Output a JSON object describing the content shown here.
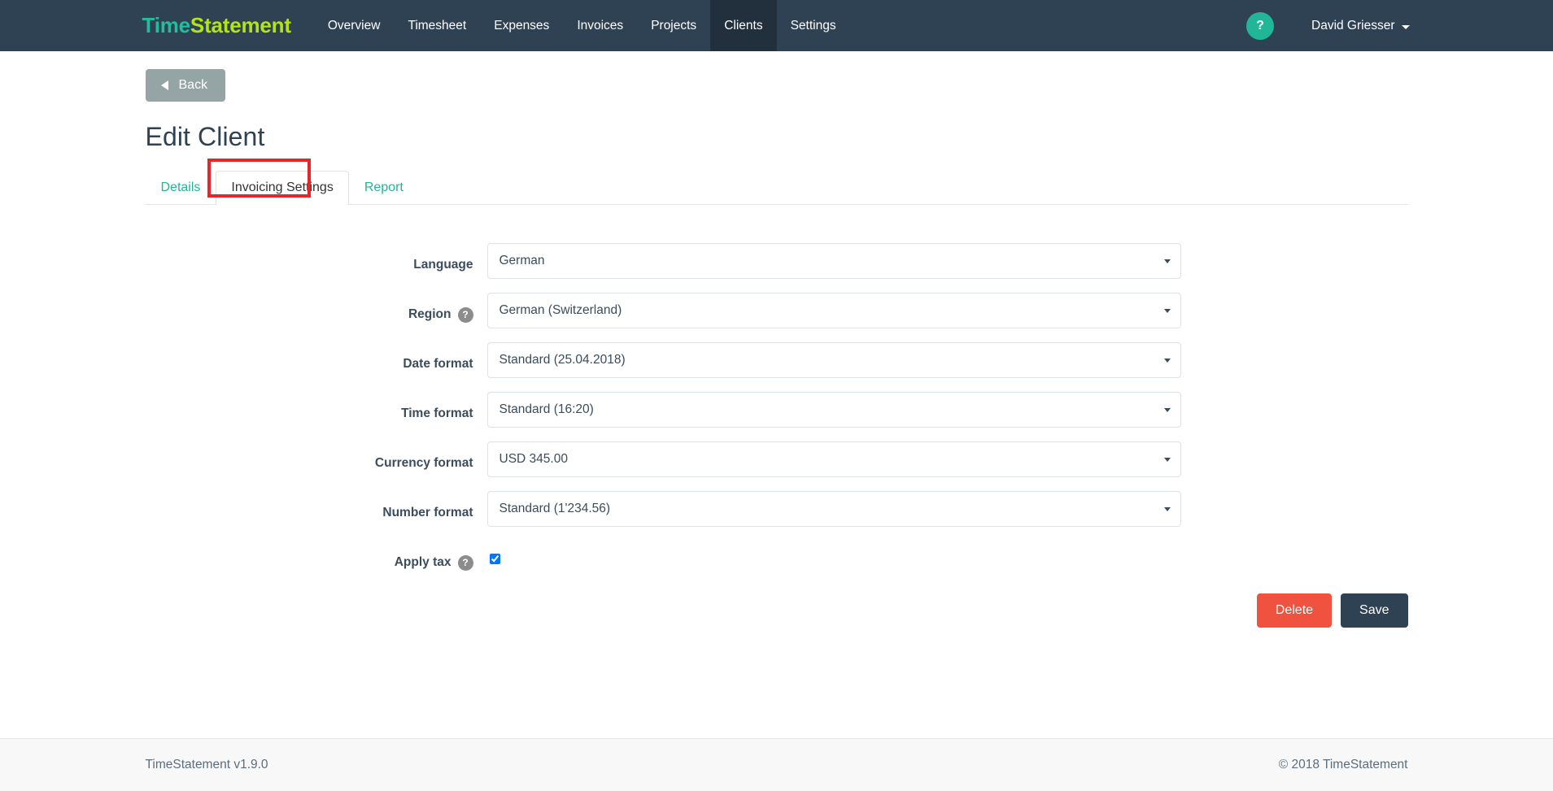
{
  "navbar": {
    "brand_part1": "Time",
    "brand_part2": "Statement",
    "links": [
      {
        "label": "Overview",
        "active": false
      },
      {
        "label": "Timesheet",
        "active": false
      },
      {
        "label": "Expenses",
        "active": false
      },
      {
        "label": "Invoices",
        "active": false
      },
      {
        "label": "Projects",
        "active": false
      },
      {
        "label": "Clients",
        "active": true
      },
      {
        "label": "Settings",
        "active": false
      }
    ],
    "help_badge": "?",
    "user_name": "David Griesser",
    "colors": {
      "background": "#2f4254",
      "active_background": "#22303d",
      "brand_teal": "#1fbf9c",
      "brand_lime": "#b4e316",
      "help_badge": "#21b698"
    }
  },
  "toolbar": {
    "back_label": "Back"
  },
  "page": {
    "title": "Edit Client"
  },
  "tabs": {
    "items": [
      {
        "label": "Details",
        "active": false
      },
      {
        "label": "Invoicing Settings",
        "active": true
      },
      {
        "label": "Report",
        "active": false
      }
    ],
    "highlight_color": "#e8252a",
    "link_color": "#21b698"
  },
  "form": {
    "rows": [
      {
        "label": "Language",
        "help": false,
        "type": "select",
        "value": "German"
      },
      {
        "label": "Region",
        "help": true,
        "type": "select",
        "value": "German (Switzerland)"
      },
      {
        "label": "Date format",
        "help": false,
        "type": "select",
        "value": "Standard (25.04.2018)"
      },
      {
        "label": "Time format",
        "help": false,
        "type": "select",
        "value": "Standard (16:20)"
      },
      {
        "label": "Currency format",
        "help": false,
        "type": "select",
        "value": "USD 345.00"
      },
      {
        "label": "Number format",
        "help": false,
        "type": "select",
        "value": "Standard (1'234.56)"
      },
      {
        "label": "Apply tax",
        "help": true,
        "type": "checkbox",
        "value": "",
        "checked": true
      }
    ],
    "help_glyph": "?",
    "delete_label": "Delete",
    "save_label": "Save",
    "delete_color": "#ef5340",
    "save_color": "#2f4254"
  },
  "footer": {
    "version": "TimeStatement v1.9.0",
    "copyright": "© 2018 TimeStatement"
  }
}
